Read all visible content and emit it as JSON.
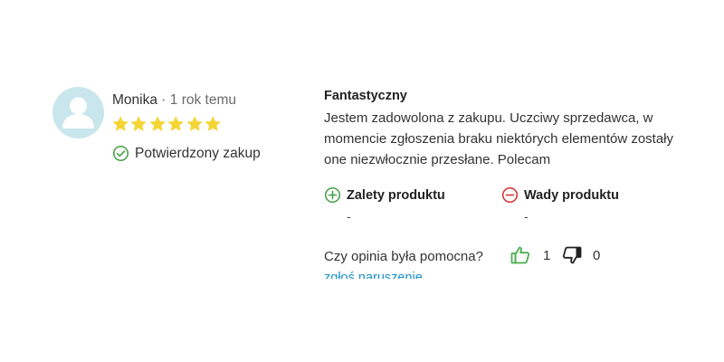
{
  "review": {
    "author": "Monika",
    "separator": "·",
    "time_ago": "1 rok temu",
    "rating": 6,
    "max_rating": 6,
    "verified_label": "Potwierdzony zakup",
    "title": "Fantastyczny",
    "body": "Jestem zadowolona z zakupu. Uczciwy sprzedawca, w momencie zgłoszenia braku niektórych elementów zostały one niezwłocznie przesłane. Polecam",
    "pros": {
      "label": "Zalety produktu",
      "value": "-"
    },
    "cons": {
      "label": "Wady produktu",
      "value": "-"
    },
    "helpful": {
      "question": "Czy opinia była pomocna?",
      "up_count": "1",
      "down_count": "0"
    },
    "report_link": "zgłoś naruszenie"
  },
  "colors": {
    "star": "#f4d535",
    "verified": "#43a047",
    "pros": "#43a047",
    "cons": "#d32f2f",
    "thumb_up": "#4caf50",
    "thumb_down": "#222222",
    "link": "#1a8fc9",
    "avatar_bg": "#c8e6ec"
  },
  "icons": {
    "avatar": "user-silhouette-icon",
    "star": "star-icon",
    "verified": "check-circle-icon",
    "pros": "plus-circle-icon",
    "cons": "minus-circle-icon",
    "thumb_up": "thumb-up-icon",
    "thumb_down": "thumb-down-icon"
  }
}
